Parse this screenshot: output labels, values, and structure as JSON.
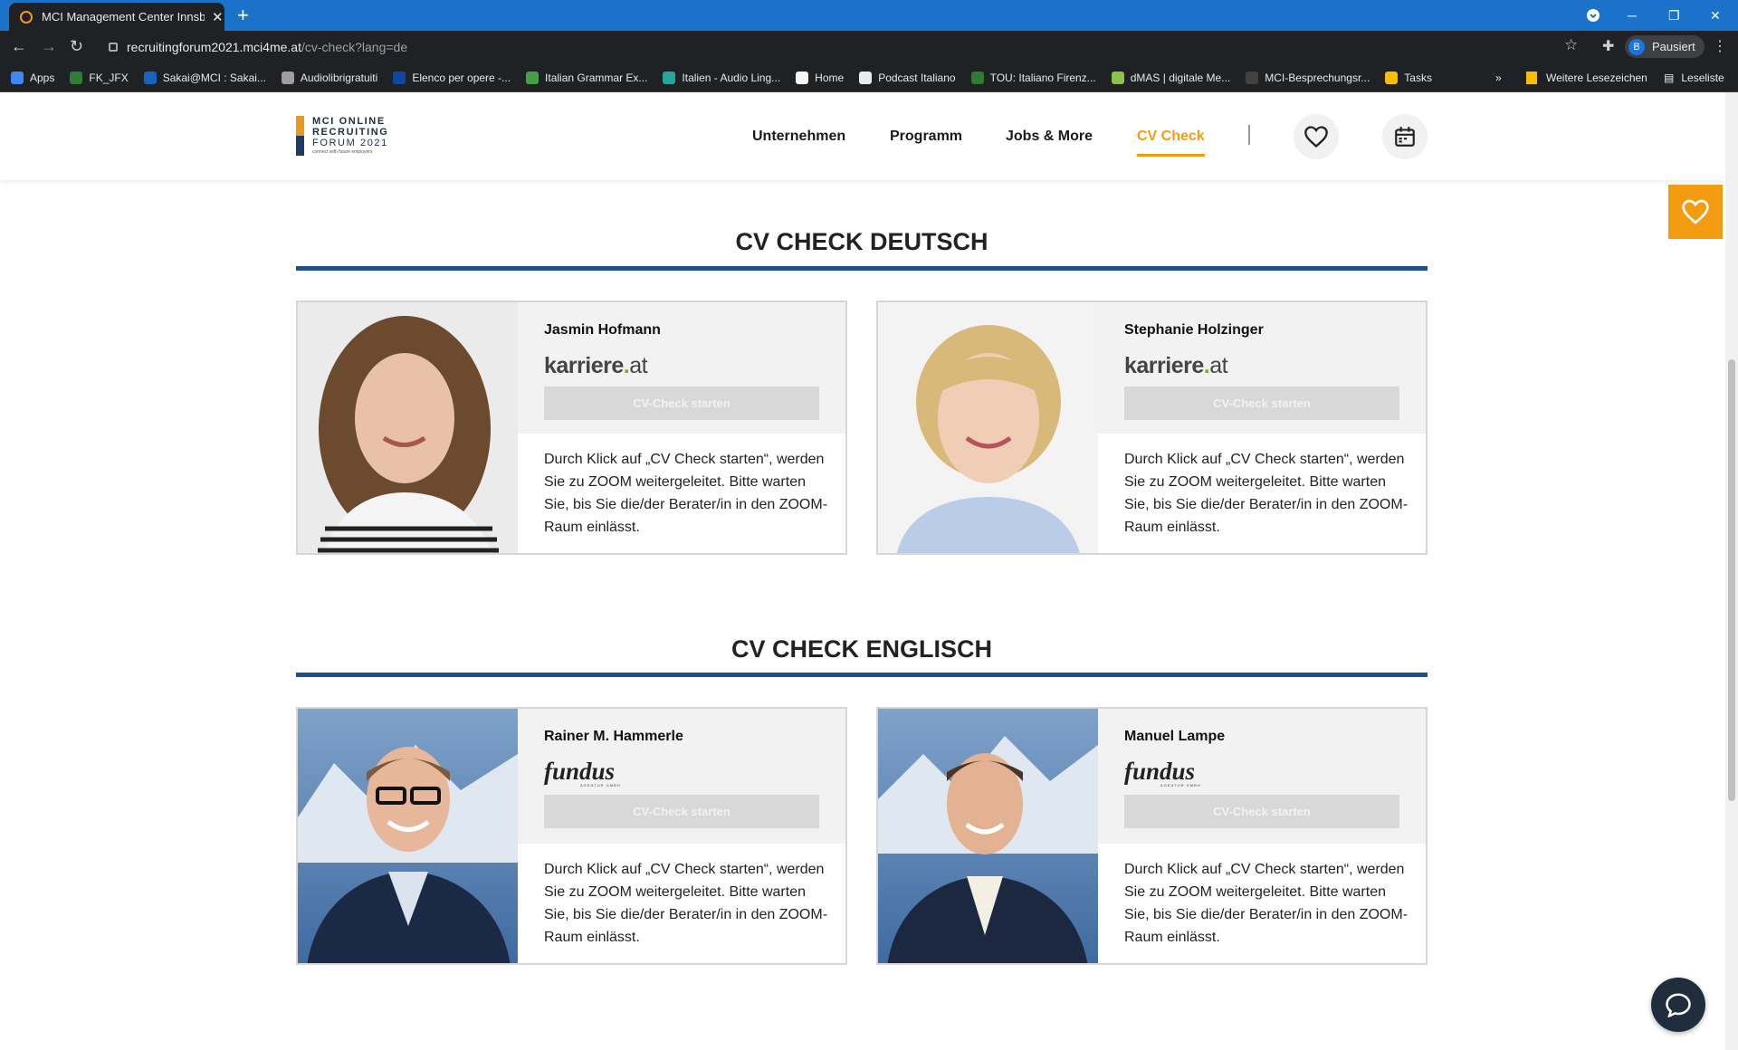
{
  "browser": {
    "tab_title": "MCI Management Center Innsbru",
    "url_host": "recruitingforum2021.mci4me.at",
    "url_path": "/cv-check?lang=de",
    "profile_initial": "B",
    "profile_status": "Pausiert",
    "bookmarks": [
      {
        "label": "Apps",
        "color": "#4285f4"
      },
      {
        "label": "FK_JFX",
        "color": "#2e7d32"
      },
      {
        "label": "Sakai@MCI : Sakai...",
        "color": "#1565c0"
      },
      {
        "label": "Audiolibrigratuiti",
        "color": "#9e9e9e"
      },
      {
        "label": "Elenco per opere -...",
        "color": "#0d47a1"
      },
      {
        "label": "Italian Grammar Ex...",
        "color": "#43a047"
      },
      {
        "label": "Italien - Audio Ling...",
        "color": "#26a69a"
      },
      {
        "label": "Home",
        "color": "#f5f5f5"
      },
      {
        "label": "Podcast Italiano",
        "color": "#e8eaed"
      },
      {
        "label": "TOU: Italiano Firenz...",
        "color": "#2e7d32"
      },
      {
        "label": "dMAS | digitale Me...",
        "color": "#8bc34a"
      },
      {
        "label": "MCI-Besprechungsr...",
        "color": "#424242"
      },
      {
        "label": "Tasks",
        "color": "#fbbc04"
      }
    ],
    "bookmarks_more": "»",
    "other_bookmarks": "Weitere Lesezeichen",
    "reading_list": "Leseliste"
  },
  "site": {
    "logo": {
      "line1": "MCI ONLINE",
      "line2": "RECRUITING",
      "line3": "FORUM 2021",
      "tagline": "connect with future employers"
    },
    "nav": [
      {
        "label": "Unternehmen",
        "active": false
      },
      {
        "label": "Programm",
        "active": false
      },
      {
        "label": "Jobs & More",
        "active": false
      },
      {
        "label": "CV Check",
        "active": true
      }
    ],
    "accent_color": "#f39c12",
    "rule_color": "#1d4f8a"
  },
  "sections": [
    {
      "title": "CV CHECK DEUTSCH",
      "cards": [
        {
          "name": "Jasmin Hofmann",
          "company": "karriere.at",
          "button": "CV-Check starten",
          "description": "Durch Klick auf „CV Check starten“, werden Sie zu ZOOM weitergeleitet. Bitte warten Sie, bis Sie die/der Berater/in in den ZOOM-Raum einlässt."
        },
        {
          "name": "Stephanie Holzinger",
          "company": "karriere.at",
          "button": "CV-Check starten",
          "description": "Durch Klick auf „CV Check starten“, werden Sie zu ZOOM weitergeleitet. Bitte warten Sie, bis Sie die/der Berater/in in den ZOOM-Raum einlässt."
        }
      ]
    },
    {
      "title": "CV CHECK ENGLISCH",
      "cards": [
        {
          "name": "Rainer M. Hammerle",
          "company": "fundus",
          "company_sub": "AGENTUR GMBH",
          "button": "CV-Check starten",
          "description": "Durch Klick auf „CV Check starten“, werden Sie zu ZOOM weitergeleitet. Bitte warten Sie, bis Sie die/der Berater/in in den ZOOM-Raum einlässt."
        },
        {
          "name": "Manuel Lampe",
          "company": "fundus",
          "company_sub": "AGENTUR GMBH",
          "button": "CV-Check starten",
          "description": "Durch Klick auf „CV Check starten“, werden Sie zu ZOOM weitergeleitet. Bitte warten Sie, bis Sie die/der Berater/in in den ZOOM-Raum einlässt."
        }
      ]
    }
  ]
}
